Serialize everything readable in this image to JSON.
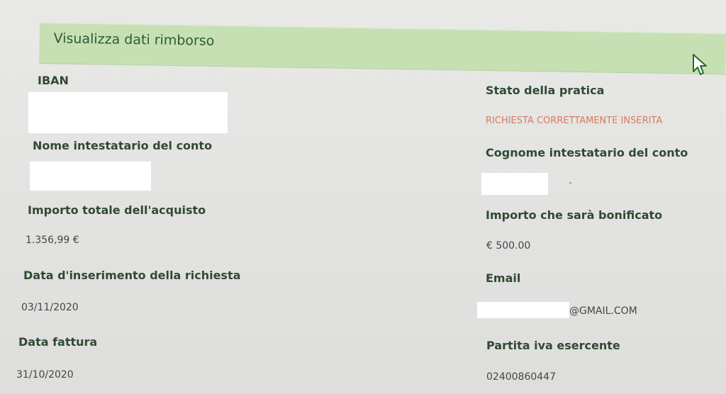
{
  "section": {
    "title": "Visualizza dati rimborso"
  },
  "fields": {
    "iban": {
      "label": "IBAN",
      "value": ""
    },
    "stato": {
      "label": "Stato della pratica",
      "value": "RICHIESTA CORRETTAMENTE INSERITA"
    },
    "nome": {
      "label": "Nome intestatario del conto",
      "value": ""
    },
    "cognome": {
      "label": "Cognome intestatario del conto",
      "value": ""
    },
    "importo_totale": {
      "label": "Importo totale dell'acquisto",
      "value": "1.356,99 €"
    },
    "importo_bonifico": {
      "label": "Importo che sarà bonificato",
      "value": "€ 500.00"
    },
    "data_inserimento": {
      "label": "Data d'inserimento della richiesta",
      "value": "03/11/2020"
    },
    "email": {
      "label": "Email",
      "value": "@GMAIL.COM"
    },
    "data_fattura": {
      "label": "Data fattura",
      "value": "31/10/2020"
    },
    "partita_iva": {
      "label": "Partita iva esercente",
      "value": "02400860447"
    }
  },
  "colors": {
    "header_bg": "#c6e0b4",
    "label": "#2f4a32",
    "status": "#d97a5c",
    "page_bg": "#e4e4e2"
  },
  "icons": {
    "cursor": "mouse-pointer-icon"
  }
}
